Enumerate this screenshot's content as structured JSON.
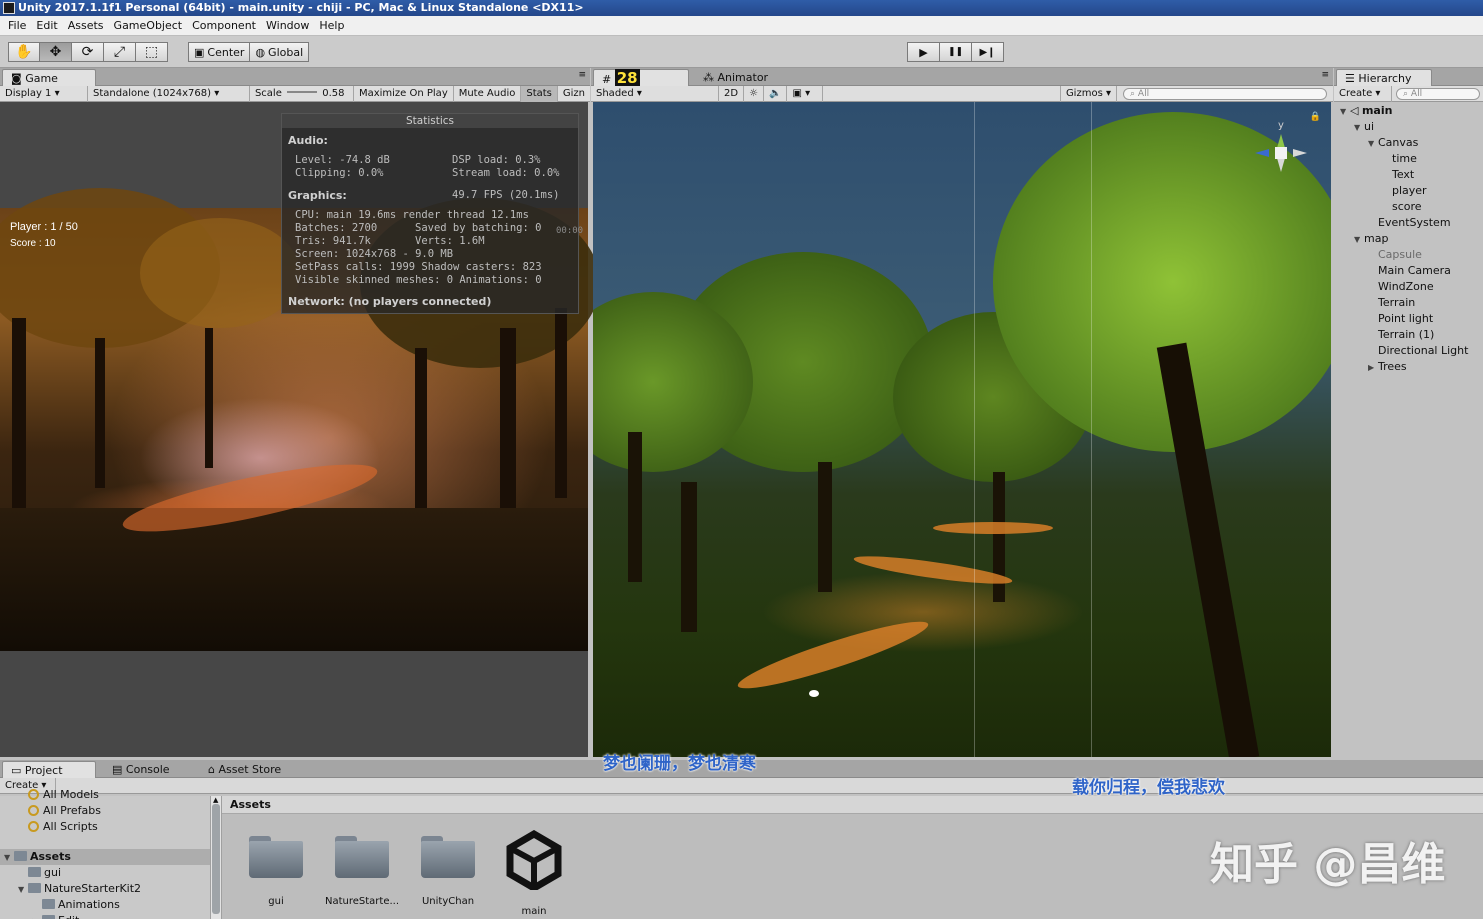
{
  "window": {
    "title": "Unity 2017.1.1f1 Personal (64bit) - main.unity - chiji - PC, Mac & Linux Standalone <DX11>"
  },
  "menu": [
    "File",
    "Edit",
    "Assets",
    "GameObject",
    "Component",
    "Window",
    "Help"
  ],
  "toolbar": {
    "tools": [
      "hand-icon",
      "move-icon",
      "rotate-icon",
      "scale-icon",
      "rect-icon"
    ],
    "pivot": "Center",
    "space": "Global",
    "play": "▶",
    "pause": "❚❚",
    "step": "▶❙"
  },
  "game": {
    "tab": "Game",
    "display": "Display 1",
    "resolution": "Standalone (1024x768)",
    "scale_label": "Scale",
    "scale_value": "0.58",
    "maximize": "Maximize On Play",
    "mute": "Mute Audio",
    "stats": "Stats",
    "gizmos_short": "Gizn",
    "hud": {
      "player": "Player : 1 / 50",
      "score": "Score : 10"
    },
    "statistics": {
      "title": "Statistics",
      "audio_header": "Audio:",
      "level": "Level: -74.8 dB",
      "dsp": "DSP load: 0.3%",
      "clipping": "Clipping: 0.0%",
      "stream": "Stream load: 0.0%",
      "graphics_header": "Graphics:",
      "fps": "49.7 FPS (20.1ms)",
      "cpu": "CPU: main 19.6ms  render thread 12.1ms",
      "batches": "Batches: 2700",
      "saved": "Saved by batching: 0",
      "tris": "Tris: 941.7k",
      "verts": "Verts: 1.6M",
      "screen": "Screen: 1024x768 - 9.0 MB",
      "setpass": "SetPass calls: 1999  Shadow casters: 823",
      "skinned": "Visible skinned meshes: 0  Animations: 0",
      "network": "Network: (no players connected)",
      "timer": "00:00"
    }
  },
  "scene": {
    "tab_number": "28",
    "animator_tab": "Animator",
    "shading": "Shaded",
    "mode_2d": "2D",
    "gizmos": "Gizmos",
    "search": "All",
    "gizmo_axis": "y",
    "subtitle_1": "梦也阑珊，梦也清寒",
    "subtitle_2": "载你归程，偿我悲欢"
  },
  "hierarchy": {
    "tab": "Hierarchy",
    "create": "Create",
    "search": "All",
    "rows": [
      {
        "label": "main",
        "indent": 0,
        "arrow": "▼",
        "bold": true
      },
      {
        "label": "ui",
        "indent": 1,
        "arrow": "▼"
      },
      {
        "label": "Canvas",
        "indent": 2,
        "arrow": "▼"
      },
      {
        "label": "time",
        "indent": 3,
        "arrow": ""
      },
      {
        "label": "Text",
        "indent": 3,
        "arrow": ""
      },
      {
        "label": "player",
        "indent": 3,
        "arrow": ""
      },
      {
        "label": "score",
        "indent": 3,
        "arrow": ""
      },
      {
        "label": "EventSystem",
        "indent": 2,
        "arrow": ""
      },
      {
        "label": "map",
        "indent": 1,
        "arrow": "▼"
      },
      {
        "label": "Capsule",
        "indent": 2,
        "arrow": "",
        "dim": true
      },
      {
        "label": "Main Camera",
        "indent": 2,
        "arrow": ""
      },
      {
        "label": "WindZone",
        "indent": 2,
        "arrow": ""
      },
      {
        "label": "Terrain",
        "indent": 2,
        "arrow": ""
      },
      {
        "label": "Point light",
        "indent": 2,
        "arrow": ""
      },
      {
        "label": "Terrain (1)",
        "indent": 2,
        "arrow": ""
      },
      {
        "label": "Directional Light",
        "indent": 2,
        "arrow": ""
      },
      {
        "label": "Trees",
        "indent": 2,
        "arrow": "▶"
      }
    ]
  },
  "project": {
    "tabs": [
      "Project",
      "Console",
      "Asset Store"
    ],
    "create": "Create",
    "favorites": [
      "All Models",
      "All Prefabs",
      "All Scripts"
    ],
    "tree": [
      {
        "label": "Assets",
        "indent": 0,
        "arrow": "▼"
      },
      {
        "label": "gui",
        "indent": 1,
        "arrow": ""
      },
      {
        "label": "NatureStarterKit2",
        "indent": 1,
        "arrow": "▼"
      },
      {
        "label": "Animations",
        "indent": 2,
        "arrow": ""
      },
      {
        "label": "Edit",
        "indent": 2,
        "arrow": "▶"
      }
    ],
    "breadcrumb": "Assets",
    "assets": [
      {
        "label": "gui",
        "kind": "folder"
      },
      {
        "label": "NatureStarte...",
        "kind": "folder"
      },
      {
        "label": "UnityChan",
        "kind": "folder"
      },
      {
        "label": "main",
        "kind": "unity-scene"
      }
    ]
  },
  "watermark": "知乎 @昌维"
}
